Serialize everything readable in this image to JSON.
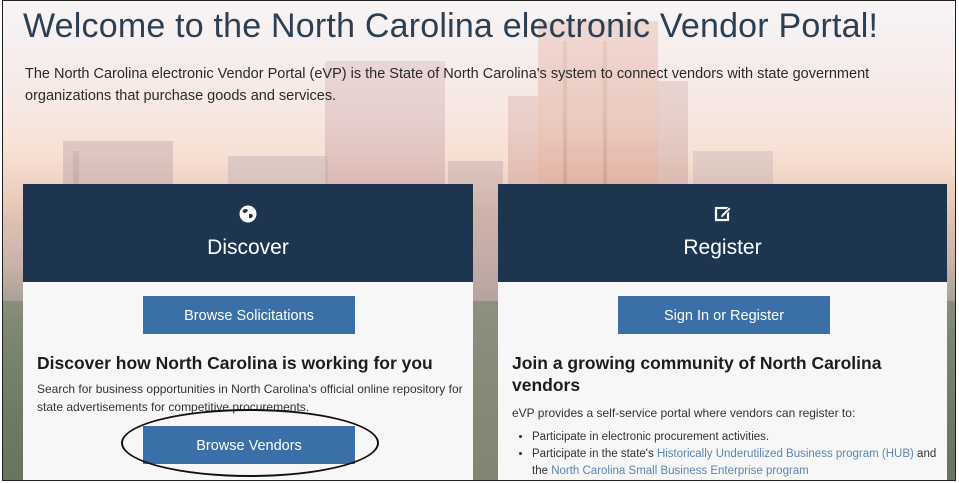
{
  "page": {
    "title": "Welcome to the North Carolina electronic Vendor Portal!",
    "intro": "The North Carolina electronic Vendor Portal (eVP) is the State of North Carolina's system to connect vendors with state government organizations that purchase goods and services."
  },
  "discover": {
    "icon": "globe-icon",
    "title": "Discover",
    "button_solicitations": "Browse Solicitations",
    "heading": "Discover how North Carolina is working for you",
    "description": "Search for business opportunities in North Carolina's official online repository for state advertisements for competitive procurements.",
    "button_vendors": "Browse Vendors"
  },
  "register": {
    "icon": "edit-icon",
    "title": "Register",
    "button_signin": "Sign In or Register",
    "heading": "Join a growing community of North Carolina vendors",
    "description": "eVP provides a self-service portal where vendors can register to:",
    "bullets": {
      "item1": "Participate in electronic procurement activities.",
      "item2_prefix": "Participate in the state's ",
      "item2_link1": "Historically Underutilized Business program (HUB)",
      "item2_mid": " and the ",
      "item2_link2": "North Carolina Small Business Enterprise program"
    }
  },
  "colors": {
    "header_navy": "#1e3550",
    "button_blue": "#3b6fa8",
    "link_blue": "#5a86b4",
    "title_text": "#2b3f55"
  }
}
